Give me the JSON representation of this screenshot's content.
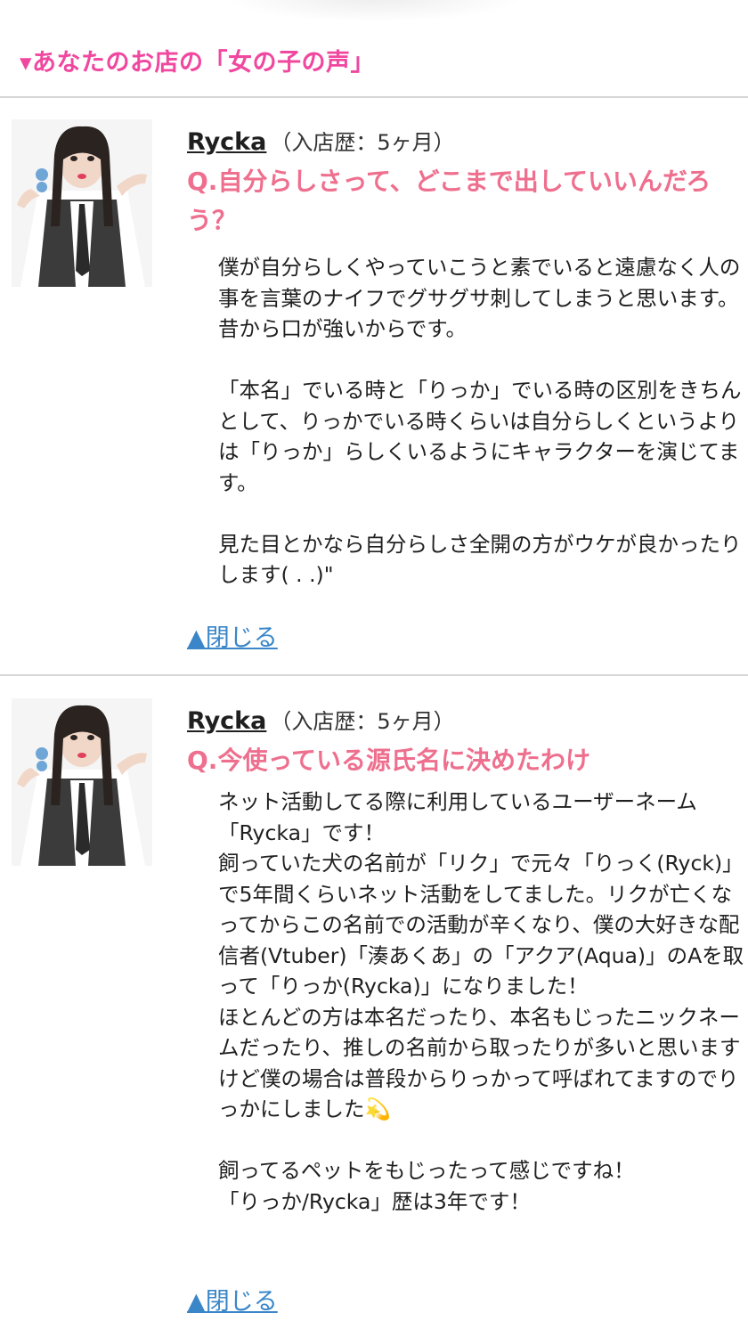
{
  "header": {
    "section_title": "▾あなたのお店の「女の子の声」"
  },
  "entries": [
    {
      "author": "Rycka",
      "tenure": "（入店歴：5ヶ月）",
      "question": "Q.自分らしさって、どこまで出していいんだろう？",
      "answer": "僕が自分らしくやっていこうと素でいると遠慮なく人の事を言葉のナイフでグサグサ刺してしまうと思います。昔から口が強いからです。\n\n「本名」でいる時と「りっか」でいる時の区別をきちんとして、りっかでいる時くらいは自分らしくというよりは「りっか」らしくいるようにキャラクターを演じてます。\n\n見た目とかなら自分らしさ全開の方がウケが良かったりします( . .)\"",
      "close_label": "▲閉じる"
    },
    {
      "author": "Rycka",
      "tenure": "（入店歴：5ヶ月）",
      "question": "Q.今使っている源氏名に決めたわけ",
      "answer": "ネット活動してる際に利用しているユーザーネーム「Rycka」です！\n飼っていた犬の名前が「リク」で元々「りっく(Ryck)」で5年間くらいネット活動をしてました。リクが亡くなってからこの名前での活動が辛くなり、僕の大好きな配信者(Vtuber)「湊あくあ」の「アクア(Aqua)」のAを取って「りっか(Rycka)」になりました！\nほとんどの方は本名だったり、本名もじったニックネームだったり、推しの名前から取ったりが多いと思いますけど僕の場合は普段からりっかって呼ばれてますのでりっかにしました💫\n\n飼ってるペットをもじったって感じですね！\n「りっか/Rycka」歴は3年です！",
      "close_label": "▲閉じる"
    }
  ]
}
